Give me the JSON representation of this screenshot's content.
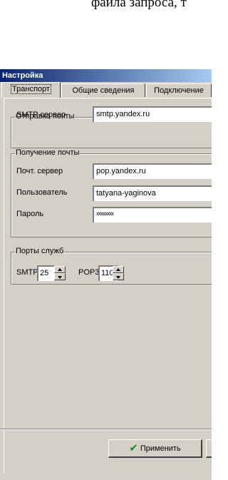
{
  "background_text": "файла запроса, т",
  "window": {
    "title": "Настройка",
    "tabs": [
      {
        "label": "Транспорт",
        "active": true
      },
      {
        "label": "Общие сведения",
        "active": false
      },
      {
        "label": "Подключение",
        "active": false
      }
    ]
  },
  "send_group": {
    "caption": "Отправка почты",
    "smtp_label": "SMTP сервер",
    "smtp_value": "smtp.yandex.ru"
  },
  "receive_group": {
    "caption": "Получение почты",
    "server_label": "Почт. сервер",
    "server_value": "pop.yandex.ru",
    "user_label": "Пользователь",
    "user_value": "tatyana-yaginova",
    "password_label": "Пароль",
    "password_value": "xxxxxxxx"
  },
  "ports_group": {
    "caption": "Порты служб",
    "smtp_label": "SMTP:",
    "smtp_value": "25",
    "pop3_label": "POP3:",
    "pop3_value": "110"
  },
  "buttons": {
    "apply_label": "Применить"
  },
  "colors": {
    "title_start": "#0a246a",
    "title_end": "#a6caf0",
    "face": "#d4d0c8",
    "apply_check": "#1a8a1a"
  }
}
